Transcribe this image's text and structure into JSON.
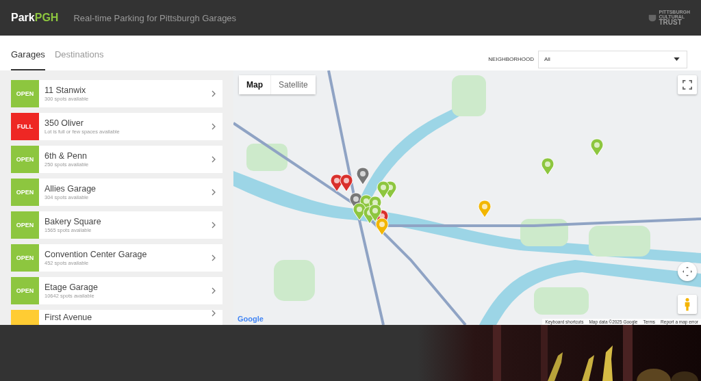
{
  "header": {
    "brand_part_1": "Park",
    "brand_part_2": "PGH",
    "tagline": "Real-time Parking for Pittsburgh Garages",
    "logo_lines": [
      "PITTSBURGH",
      "CULTURAL",
      "TRUST"
    ]
  },
  "tabs": [
    {
      "label": "Garages",
      "selected": true
    },
    {
      "label": "Destinations",
      "selected": false
    }
  ],
  "filter": {
    "label": "NEIGHBORHOOD",
    "value": "All"
  },
  "garages": [
    {
      "status": "OPEN",
      "kind": "open",
      "name": "11 Stanwix",
      "detail": "300 spots available"
    },
    {
      "status": "FULL",
      "kind": "full",
      "name": "350 Oliver",
      "detail": "Lot is full or few spaces available"
    },
    {
      "status": "OPEN",
      "kind": "open",
      "name": "6th & Penn",
      "detail": "250 spots available"
    },
    {
      "status": "OPEN",
      "kind": "open",
      "name": "Allies Garage",
      "detail": "304 spots available"
    },
    {
      "status": "OPEN",
      "kind": "open",
      "name": "Bakery Square",
      "detail": "1565 spots available"
    },
    {
      "status": "OPEN",
      "kind": "open",
      "name": "Convention Center Garage",
      "detail": "452 spots available"
    },
    {
      "status": "OPEN",
      "kind": "open",
      "name": "Etage Garage",
      "detail": "10642 spots available"
    },
    {
      "kind": "limited",
      "name": "First Avenue"
    }
  ],
  "map": {
    "types": [
      {
        "label": "Map",
        "selected": true
      },
      {
        "label": "Satellite",
        "selected": false
      }
    ],
    "attribution": [
      "Keyboard shortcuts",
      "Map data ©2025 Google",
      "Terms",
      "Report a map error"
    ],
    "logo": "Google"
  }
}
